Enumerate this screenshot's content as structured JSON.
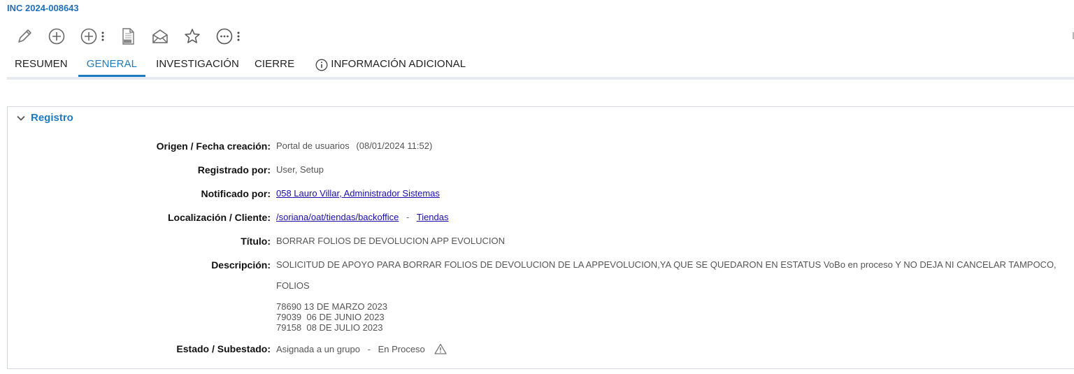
{
  "header": {
    "incident_id": "INC 2024-008643"
  },
  "toolbar": {
    "icons": [
      "pencil-icon",
      "plus-circle-icon",
      "plus-circle-icon",
      "more-vertical-icon",
      "pdf-icon",
      "envelope-open-icon",
      "star-icon",
      "more-horizontal-icon",
      "more-vertical-icon"
    ]
  },
  "tabs": [
    {
      "label": "RESUMEN",
      "active": false
    },
    {
      "label": "GENERAL",
      "active": true
    },
    {
      "label": "INVESTIGACIÓN",
      "active": false
    },
    {
      "label": "CIERRE",
      "active": false
    },
    {
      "label": "INFORMACIÓN ADICIONAL",
      "active": false
    }
  ],
  "registro": {
    "title": "Registro",
    "origen": {
      "label": "Origen / Fecha creación:",
      "value": "Portal de usuarios",
      "date": "(08/01/2024 11:52)"
    },
    "registrado": {
      "label": "Registrado por:",
      "value": "User, Setup"
    },
    "notificado": {
      "label": "Notificado por:",
      "value": "058 Lauro Villar, Administrador Sistemas"
    },
    "localizacion": {
      "label": "Localización / Cliente:",
      "value": "/soriana/oat/tiendas/backoffice",
      "sep": "-",
      "cliente": "Tiendas"
    },
    "titulo": {
      "label": "Título:",
      "value": "BORRAR FOLIOS DE DEVOLUCION APP EVOLUCION"
    },
    "descripcion": {
      "label": "Descripción:",
      "line1": "SOLICITUD DE APOYO PARA BORRAR FOLIOS DE DEVOLUCION DE LA APPEVOLUCION,YA QUE SE QUEDARON EN ESTATUS VoBo en proceso Y NO DEJA NI CANCELAR TAMPOCO,",
      "line2": "FOLIOS",
      "folios": [
        "78690 13 DE MARZO 2023",
        "79039  06 DE JUNIO 2023",
        "79158  08 DE JULIO 2023"
      ]
    },
    "estado": {
      "label": "Estado / Subestado:",
      "value": "Asignada a un grupo",
      "sep": "-",
      "subestado": "En Proceso"
    }
  },
  "colors": {
    "accent": "#1f7bc1",
    "link": "#1a0dab",
    "icon": "#666666"
  }
}
